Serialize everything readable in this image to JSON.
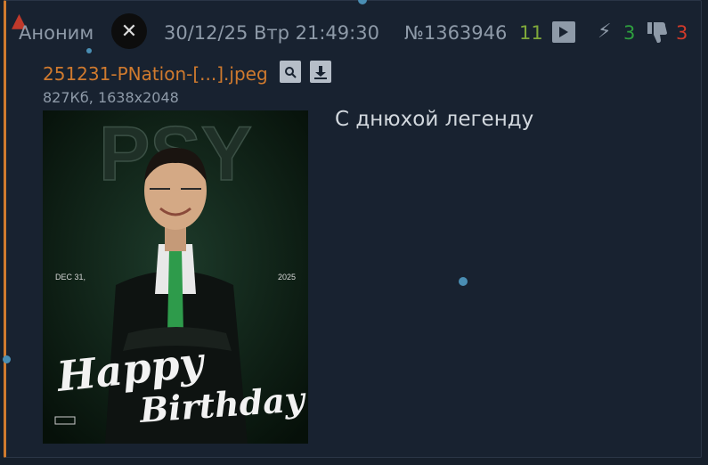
{
  "post": {
    "author": "Аноним",
    "avatar_label": "✕",
    "date": "30/12/25 Втр 21:49:30",
    "number": "№1363946",
    "replies": "11",
    "likes": "3",
    "dislikes": "3",
    "file": {
      "name": "251231-PNation-[...].jpeg",
      "info": "827Кб, 1638x2048"
    },
    "image": {
      "headline": "PSY",
      "left_date": "DEC 31,",
      "right_year": "2025",
      "happy": "Happy",
      "birthday": "Birthday"
    },
    "message": "С днюхой легенду"
  },
  "icons": {
    "hat": "santa-hat-icon",
    "play": "play-icon",
    "bolt": "bolt-icon",
    "dislike": "thumbs-down-icon",
    "search": "search-icon",
    "download": "download-icon"
  },
  "colors": {
    "background": "#182230",
    "accent": "#d07a2e",
    "likes": "#2e9e3e",
    "dislikes": "#d13a2a",
    "replies": "#7fa83a",
    "muted": "#8e9aa8"
  }
}
